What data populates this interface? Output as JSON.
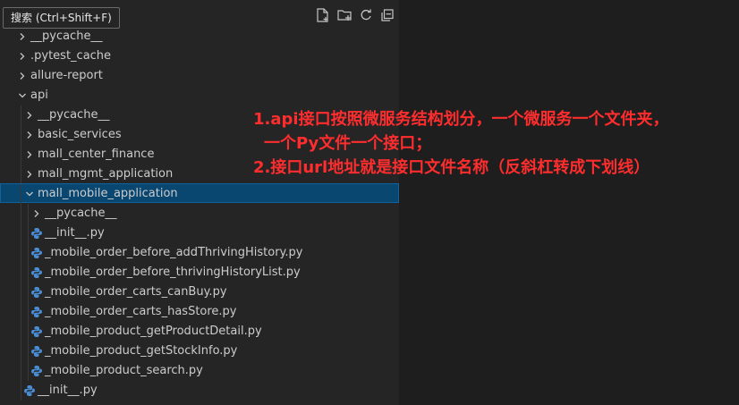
{
  "tooltip": {
    "text": "搜索 (Ctrl+Shift+F)"
  },
  "toolbar": [
    {
      "name": "new-file-icon"
    },
    {
      "name": "new-folder-icon"
    },
    {
      "name": "refresh-icon"
    },
    {
      "name": "collapse-all-icon"
    }
  ],
  "tree": [
    {
      "label": "__pycache__",
      "type": "folder",
      "depth": 0,
      "expanded": false
    },
    {
      "label": ".pytest_cache",
      "type": "folder",
      "depth": 0,
      "expanded": false
    },
    {
      "label": "allure-report",
      "type": "folder",
      "depth": 0,
      "expanded": false
    },
    {
      "label": "api",
      "type": "folder",
      "depth": 0,
      "expanded": true
    },
    {
      "label": "__pycache__",
      "type": "folder",
      "depth": 1,
      "expanded": false
    },
    {
      "label": "basic_services",
      "type": "folder",
      "depth": 1,
      "expanded": false
    },
    {
      "label": "mall_center_finance",
      "type": "folder",
      "depth": 1,
      "expanded": false
    },
    {
      "label": "mall_mgmt_application",
      "type": "folder",
      "depth": 1,
      "expanded": false
    },
    {
      "label": "mall_mobile_application",
      "type": "folder",
      "depth": 1,
      "expanded": true,
      "selected": true
    },
    {
      "label": "__pycache__",
      "type": "folder",
      "depth": 2,
      "expanded": false
    },
    {
      "label": "__init__.py",
      "type": "python",
      "depth": 2
    },
    {
      "label": "_mobile_order_before_addThrivingHistory.py",
      "type": "python",
      "depth": 2
    },
    {
      "label": "_mobile_order_before_thrivingHistoryList.py",
      "type": "python",
      "depth": 2
    },
    {
      "label": "_mobile_order_carts_canBuy.py",
      "type": "python",
      "depth": 2
    },
    {
      "label": "_mobile_order_carts_hasStore.py",
      "type": "python",
      "depth": 2
    },
    {
      "label": "_mobile_product_getProductDetail.py",
      "type": "python",
      "depth": 2
    },
    {
      "label": "_mobile_product_getStockInfo.py",
      "type": "python",
      "depth": 2
    },
    {
      "label": "_mobile_product_search.py",
      "type": "python",
      "depth": 2
    },
    {
      "label": "__init__.py",
      "type": "python",
      "depth": 1
    }
  ],
  "annotation": {
    "line1": "1.api接口按照微服务结构划分，一个微服务一个文件夹，",
    "line2": "一个Py文件一个接口；",
    "line3": "2.接口url地址就是接口文件名称（反斜杠转成下划线）"
  },
  "colors": {
    "sidebar_bg": "#252526",
    "editor_bg": "#1e1e1e",
    "selection": "#094771",
    "annotation": "#ff2d2d"
  }
}
